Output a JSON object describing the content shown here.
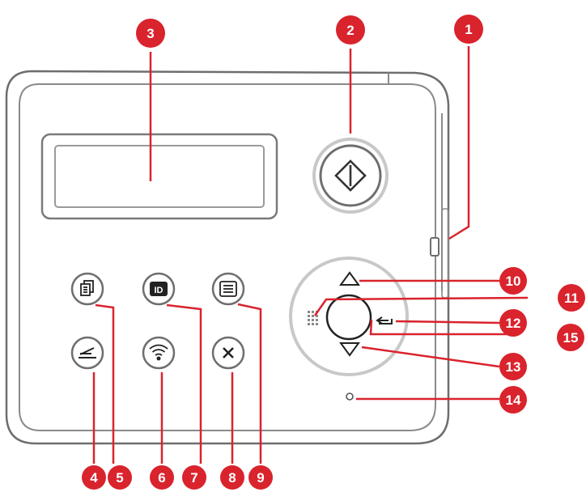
{
  "colors": {
    "callout": "#d9232d",
    "outline": "#6e6e6e",
    "ring": "#c8c8c8",
    "button_fill": "#ffffff"
  },
  "callouts": {
    "n1": "1",
    "n2": "2",
    "n3": "3",
    "n4": "4",
    "n5": "5",
    "n6": "6",
    "n7": "7",
    "n8": "8",
    "n9": "9",
    "n10": "10",
    "n11": "11",
    "n12": "12",
    "n13": "13",
    "n14": "14",
    "n15": "15"
  },
  "icons": {
    "start": "start-diamond-icon",
    "copy": "copy-icon",
    "id_copy": "id-card-icon",
    "menu": "menu-list-icon",
    "scan": "scan-icon",
    "wifi": "wifi-icon",
    "cancel": "cancel-x-icon",
    "up": "up-arrow-icon",
    "down": "down-arrow-icon",
    "back": "back-icon",
    "menu_small": "menu-grid-icon"
  },
  "labels": {
    "id": "ID"
  }
}
